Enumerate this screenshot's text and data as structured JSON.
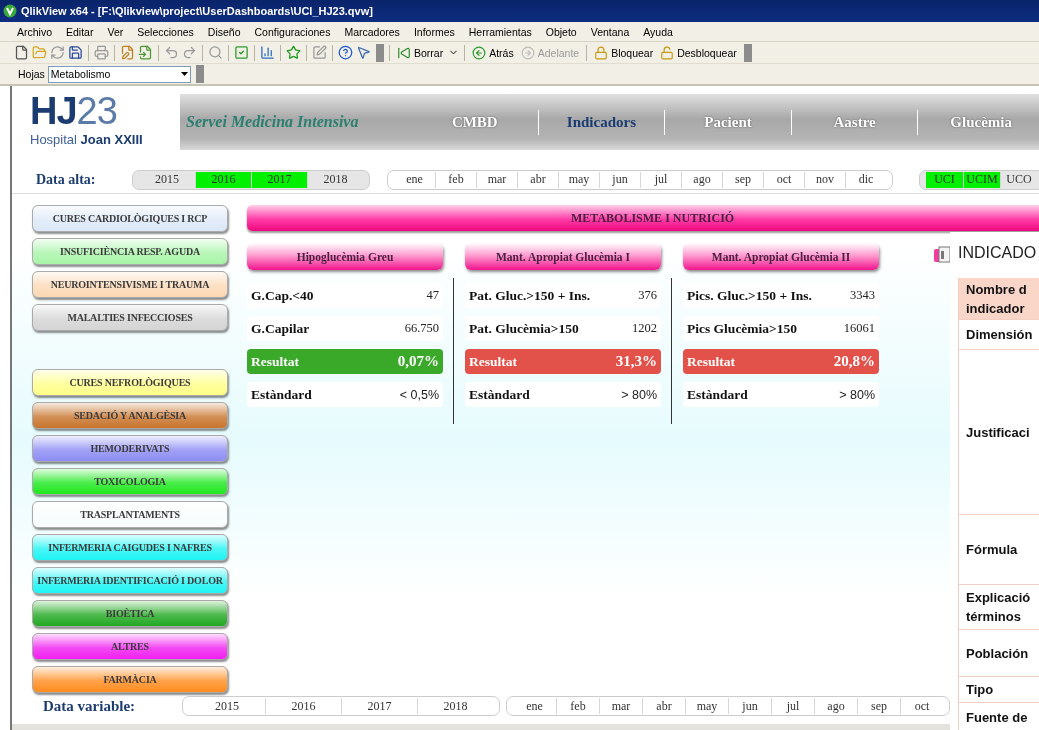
{
  "window": {
    "title": "QlikView x64 - [F:\\Qlikview\\project\\UserDashboards\\UCI_HJ23.qvw]"
  },
  "menu": [
    "Archivo",
    "Editar",
    "Ver",
    "Selecciones",
    "Diseño",
    "Configuraciones",
    "Marcadores",
    "Informes",
    "Herramientas",
    "Objeto",
    "Ventana",
    "Ayuda"
  ],
  "toolbar": {
    "buttons": [
      {
        "label": "Borrar",
        "disabled": false,
        "dropdown": true
      },
      {
        "label": "Atrás",
        "disabled": false,
        "dropdown": false
      },
      {
        "label": "Adelante",
        "disabled": true,
        "dropdown": false
      },
      {
        "label": "Bloquear",
        "disabled": false,
        "dropdown": false
      },
      {
        "label": "Desbloquear",
        "disabled": false,
        "dropdown": false
      }
    ]
  },
  "sheets": {
    "label": "Hojas",
    "value": "Metabolismo"
  },
  "header": {
    "logo": {
      "letters": "HJ",
      "digits": "23",
      "caption": "Hospital **Joan XXIII**"
    },
    "subtitle": "Servei Medicina Intensiva",
    "tabs": [
      {
        "label": "CMBD",
        "selected": false
      },
      {
        "label": "Indicadors",
        "selected": true
      },
      {
        "label": "Pacient",
        "selected": false
      },
      {
        "label": "Aastre",
        "selected": false
      },
      {
        "label": "Glucèmia",
        "selected": false
      }
    ]
  },
  "filters": {
    "label": "Data alta:",
    "years": [
      {
        "label": "2015",
        "selected": false
      },
      {
        "label": "2016",
        "selected": true
      },
      {
        "label": "2017",
        "selected": true
      },
      {
        "label": "2018",
        "selected": false
      }
    ],
    "months": [
      {
        "label": "ene",
        "selected": false
      },
      {
        "label": "feb",
        "selected": false
      },
      {
        "label": "mar",
        "selected": false
      },
      {
        "label": "abr",
        "selected": false
      },
      {
        "label": "may",
        "selected": false
      },
      {
        "label": "jun",
        "selected": false
      },
      {
        "label": "jul",
        "selected": false
      },
      {
        "label": "ago",
        "selected": false
      },
      {
        "label": "sep",
        "selected": false
      },
      {
        "label": "oct",
        "selected": false
      },
      {
        "label": "nov",
        "selected": false
      },
      {
        "label": "dic",
        "selected": false
      }
    ],
    "units": [
      {
        "label": "UCI",
        "selected": true
      },
      {
        "label": "UCIM",
        "selected": true
      },
      {
        "label": "UCO",
        "selected": false
      }
    ]
  },
  "sidebar": {
    "groups": [
      {
        "items": [
          {
            "label": "CURES CARDIOLÒGIQUES I RCP",
            "color": "#dce8f8"
          },
          {
            "label": "INSUFICIÈNCIA RESP. AGUDA",
            "color": "#a8f4a8"
          },
          {
            "label": "NEUROINTENSIVISME I TRAUMA",
            "color": "#fcd8b4"
          },
          {
            "label": "MALALTIES INFECCIOSES",
            "color": "#d4d4d4"
          }
        ]
      },
      {
        "items": [
          {
            "label": "CURES NEFROLÒGIQUES",
            "color": "#ffff88"
          },
          {
            "label": "SEDACIÓ Y ANALGÈSIA",
            "color": "#c8742c"
          },
          {
            "label": "HEMODERIVATS",
            "color": "#8c8cf4"
          },
          {
            "label": "TOXICOLOGIA",
            "color": "#1ee81e"
          },
          {
            "label": "TRASPLANTAMENTS",
            "color": "#f8fcfc"
          },
          {
            "label": "INFERMERIA CAIGUDES I NAFRES",
            "color": "#1ef4f4"
          },
          {
            "label": "INFERMERIA IDENTIFICACIÓ I DOLOR",
            "color": "#1ef4f4"
          },
          {
            "label": "BIOÈTICA",
            "color": "#22a822"
          },
          {
            "label": "ALTRES",
            "color": "#f01ef0"
          },
          {
            "label": "FARMÀCIA",
            "color": "#ff8c1e"
          }
        ]
      }
    ]
  },
  "section": {
    "title": "METABOLISME I NUTRICIÓ"
  },
  "indicators": [
    {
      "title": "Hipoglucèmia Greu",
      "rows": [
        {
          "label": "G.Cap.<40",
          "value": "47"
        },
        {
          "label": "G.Capilar",
          "value": "66.750"
        }
      ],
      "result": {
        "label": "Resultat",
        "value": "0,07%",
        "color": "#3aa829"
      },
      "standard": {
        "label": "Estàndard",
        "value": "< 0,5%"
      }
    },
    {
      "title": "Mant. Apropiat Glucèmia I",
      "rows": [
        {
          "label": "Pat. Gluc.>150 + Ins.",
          "value": "376"
        },
        {
          "label": "Pat. Glucèmia>150",
          "value": "1202"
        }
      ],
      "result": {
        "label": "Resultat",
        "value": "31,3%",
        "color": "#e2524a"
      },
      "standard": {
        "label": "Estàndard",
        "value": "> 80%"
      }
    },
    {
      "title": "Mant. Apropiat Glucèmia II",
      "rows": [
        {
          "label": "Pics. Gluc.>150 + Ins.",
          "value": "3343"
        },
        {
          "label": "Pics Glucèmia>150",
          "value": "16061"
        }
      ],
      "result": {
        "label": "Resultat",
        "value": "20,8%",
        "color": "#e2524a"
      },
      "standard": {
        "label": "Estàndard",
        "value": "> 80%"
      }
    }
  ],
  "info_panel": {
    "title": "INDICADO",
    "rows": [
      {
        "lines": [
          "Nombre d",
          "indicador"
        ],
        "shaded": true
      },
      {
        "lines": [
          "Dimensión"
        ],
        "shaded": false
      },
      {
        "lines": [
          "Justificaci"
        ],
        "shaded": false
      },
      {
        "lines": [
          "Fórmula"
        ],
        "shaded": false
      },
      {
        "lines": [
          "Explicació",
          "términos"
        ],
        "shaded": false
      },
      {
        "lines": [
          "Población"
        ],
        "shaded": false
      },
      {
        "lines": [
          "Tipo"
        ],
        "shaded": false
      },
      {
        "lines": [
          "Fuente de"
        ],
        "shaded": false
      }
    ]
  },
  "bottom_filters": {
    "label": "Data variable:",
    "years": [
      {
        "label": "2015",
        "selected": false
      },
      {
        "label": "2016",
        "selected": false
      },
      {
        "label": "2017",
        "selected": false
      },
      {
        "label": "2018",
        "selected": false
      }
    ],
    "months": [
      {
        "label": "ene",
        "selected": false
      },
      {
        "label": "feb",
        "selected": false
      },
      {
        "label": "mar",
        "selected": false
      },
      {
        "label": "abr",
        "selected": false
      },
      {
        "label": "may",
        "selected": false
      },
      {
        "label": "jun",
        "selected": false
      },
      {
        "label": "jul",
        "selected": false
      },
      {
        "label": "ago",
        "selected": false
      },
      {
        "label": "sep",
        "selected": false
      },
      {
        "label": "oct",
        "selected": false
      }
    ]
  }
}
